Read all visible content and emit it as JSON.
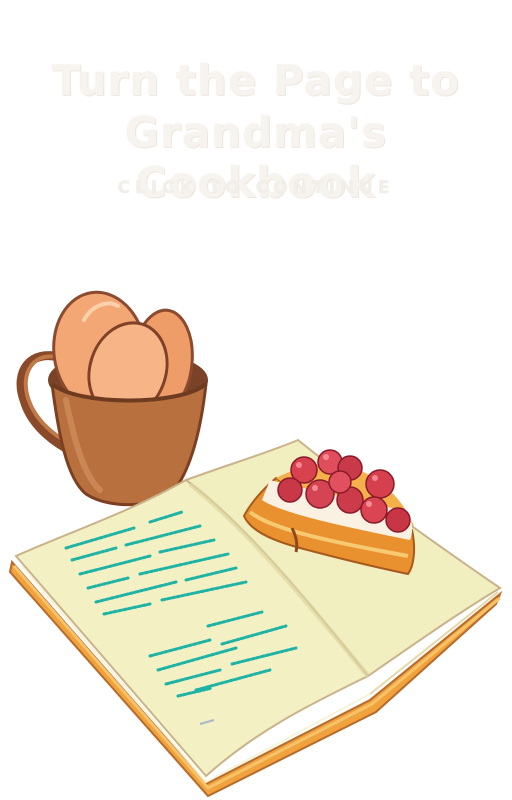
{
  "screen": {
    "title_line1": "Turn the Page to",
    "title_line2": "Grandma's Cookbook",
    "prompt": "CLICK TO CONTINUE"
  },
  "colors": {
    "title": "#f7f3ee",
    "mug": "#b8703f",
    "egg": "#f0a06a",
    "book_page": "#f3f0c4",
    "book_cover": "#f0a33c",
    "cherry": "#d8424f",
    "text_lines": "#1fb3a6"
  },
  "icons": [
    "mug-of-eggs-illustration",
    "open-cookbook-illustration",
    "cherry-tart-illustration"
  ]
}
